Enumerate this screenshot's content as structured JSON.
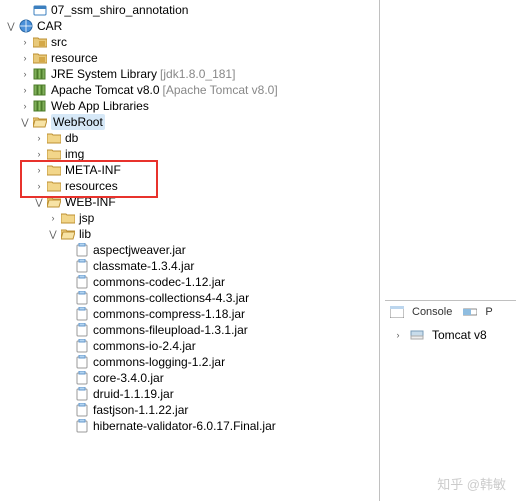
{
  "tree": {
    "annotation": "07_ssm_shiro_annotation",
    "car": "CAR",
    "src": "src",
    "resource": "resource",
    "jre": "JRE System Library",
    "jre_ver": "[jdk1.8.0_181]",
    "tomcat": "Apache Tomcat v8.0",
    "tomcat_ver": "[Apache Tomcat v8.0]",
    "webapp": "Web App Libraries",
    "webroot": "WebRoot",
    "db": "db",
    "img": "img",
    "metainf": "META-INF",
    "resources": "resources",
    "webinf": "WEB-INF",
    "jsp": "jsp",
    "lib": "lib",
    "jars": {
      "j0": "aspectjweaver.jar",
      "j1": "classmate-1.3.4.jar",
      "j2": "commons-codec-1.12.jar",
      "j3": "commons-collections4-4.3.jar",
      "j4": "commons-compress-1.18.jar",
      "j5": "commons-fileupload-1.3.1.jar",
      "j6": "commons-io-2.4.jar",
      "j7": "commons-logging-1.2.jar",
      "j8": "core-3.4.0.jar",
      "j9": "druid-1.1.19.jar",
      "j10": "fastjson-1.1.22.jar",
      "j11": "hibernate-validator-6.0.17.Final.jar"
    }
  },
  "console": {
    "tab_console": "Console",
    "tab_progress": "P",
    "server": "Tomcat v8"
  },
  "expander": {
    "open": "⋁",
    "closed": "›",
    "arrow": "›"
  },
  "watermark": "知乎 @韩敏"
}
